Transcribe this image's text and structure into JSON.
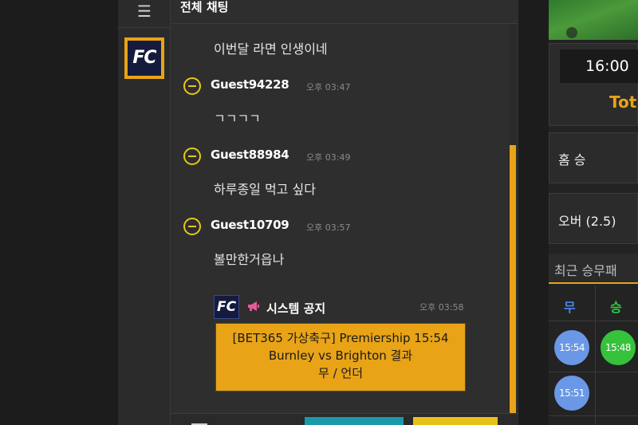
{
  "sidebar": {
    "menu_icon": "☰",
    "logo_text": "FC"
  },
  "chat": {
    "title": "전체 채팅",
    "messages": [
      {
        "user": "",
        "time": "",
        "text": "이번달 라면 인생이네"
      },
      {
        "user": "Guest94228",
        "time": "오후 03:47",
        "text": "ㄱㄱㄱㄱ"
      },
      {
        "user": "Guest88984",
        "time": "오후 03:49",
        "text": "하루종일 먹고 싶다"
      },
      {
        "user": "Guest10709",
        "time": "오후 03:57",
        "text": "볼만한거읍나"
      }
    ],
    "system": {
      "logo_text": "FC",
      "title": "시스템 공지",
      "time": "오후 03:58",
      "lines": [
        "[BET365 가상축구] Premiership 15:54",
        "Burnley vs Brighton 결과",
        "무 / 언더"
      ]
    }
  },
  "match": {
    "time": "16:00",
    "team": "Tot"
  },
  "bets": [
    {
      "label": "홈 승"
    },
    {
      "label": "오버 (2.5)"
    }
  ],
  "recent": {
    "title": "최근 승무패",
    "columns": [
      {
        "label": "무",
        "color": "#4a86e8"
      },
      {
        "label": "승",
        "color": "#2ecc40"
      }
    ],
    "results": [
      {
        "time": "15:54",
        "color": "#6a98e6"
      },
      {
        "time": "15:48",
        "color": "#36c23a"
      },
      {
        "time": "15:51",
        "color": "#6a98e6"
      }
    ]
  },
  "colors": {
    "accent": "#e8a317",
    "draw": "#4a86e8",
    "win": "#2ecc40"
  }
}
